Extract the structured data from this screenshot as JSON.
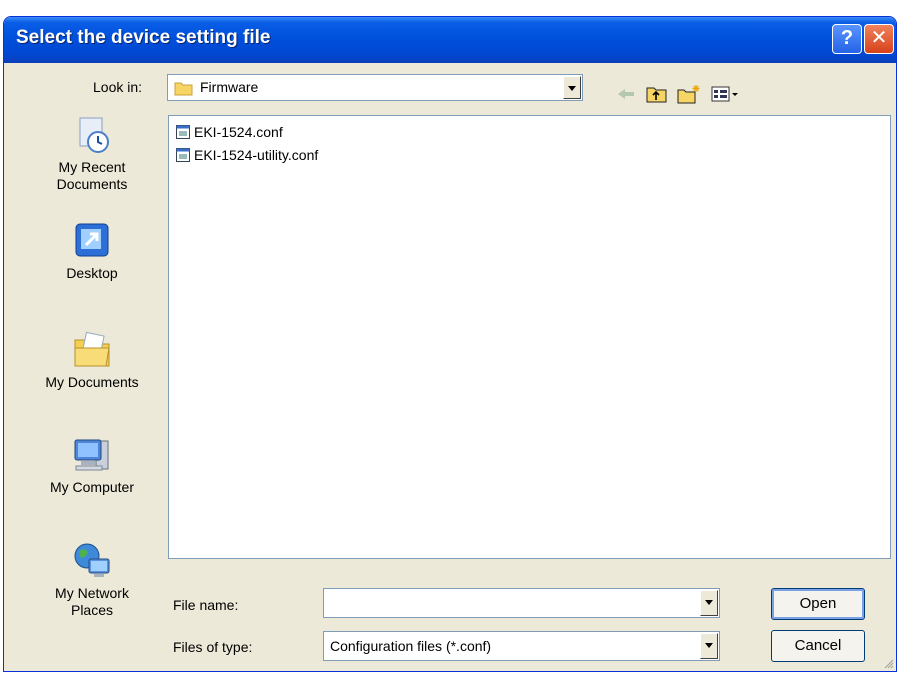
{
  "window": {
    "title": "Select the device setting file"
  },
  "lookin": {
    "label": "Look in:",
    "value": "Firmware"
  },
  "toolbar": {
    "back_icon": "back-arrow-icon",
    "up_icon": "up-folder-icon",
    "newfolder_icon": "new-folder-icon",
    "views_icon": "views-menu-icon"
  },
  "places": [
    {
      "label_line1": "My Recent",
      "label_line2": "Documents"
    },
    {
      "label_line1": "Desktop"
    },
    {
      "label_line1": "My Documents"
    },
    {
      "label_line1": "My Computer"
    },
    {
      "label_line1": "My Network",
      "label_line2": "Places"
    }
  ],
  "files": [
    {
      "name": "EKI-1524.conf"
    },
    {
      "name": "EKI-1524-utility.conf"
    }
  ],
  "filename": {
    "label": "File name:",
    "value": ""
  },
  "filetype": {
    "label": "Files of type:",
    "value": "Configuration files (*.conf)"
  },
  "buttons": {
    "open": "Open",
    "cancel": "Cancel"
  },
  "colors": {
    "titlebar": "#0050dc",
    "dialog": "#ece9d8",
    "border": "#7f9db9"
  }
}
